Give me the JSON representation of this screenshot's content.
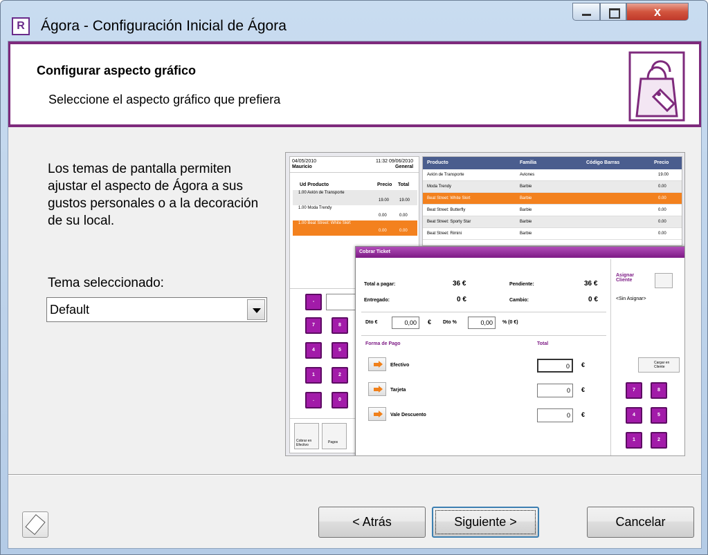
{
  "window": {
    "title": "Ágora - Configuración Inicial de Ágora",
    "app_icon_text": "R",
    "close_label": "x"
  },
  "header": {
    "title": "Configurar aspecto gráfico",
    "subtitle": "Seleccione el aspecto gráfico que prefiera"
  },
  "content": {
    "description": "Los temas de pantalla permiten ajustar el aspecto de Ágora a sus gustos personales o a la decoración de su local.",
    "theme_label": "Tema seleccionado:",
    "theme_value": "Default"
  },
  "preview": {
    "left_date": "04/05/2010",
    "left_user": "Mauricio",
    "left_time": "11:32 09/06/2010",
    "left_mode": "General",
    "col_ud_producto": "Ud Producto",
    "col_precio": "Precio",
    "col_total": "Total",
    "ticket_lines": [
      {
        "text": "1.00 Avión de Transporte",
        "price": "19.00",
        "total": "19.00"
      },
      {
        "text": "1.00 Moda Trendy",
        "price": "0.00",
        "total": "0.00"
      },
      {
        "text": "1.00 Beat Street: White Skirt",
        "price": "0.00",
        "total": "0.00"
      }
    ],
    "product_headers": [
      "Producto",
      "Familia",
      "Código Barras",
      "Precio"
    ],
    "products": [
      {
        "name": "Avión de Transporte",
        "family": "Aviones",
        "price": "19.00"
      },
      {
        "name": "Moda Trendy",
        "family": "Barbie",
        "price": "0.00"
      },
      {
        "name": "Beat Street: White Skirt",
        "family": "Barbie",
        "price": "0.00"
      },
      {
        "name": "Beat Street: Butterfly",
        "family": "Barbie",
        "price": "0.00"
      },
      {
        "name": "Beat Street: Sporty Star",
        "family": "Barbie",
        "price": "0.00"
      },
      {
        "name": "Beat Street: Rimini",
        "family": "Barbie",
        "price": "0.00"
      }
    ],
    "keypad": [
      "-",
      "7",
      "8",
      "4",
      "5",
      "1",
      "2",
      ".",
      "0"
    ],
    "bottom_buttons": [
      "Cobrar en Efectivo",
      "Pagos"
    ],
    "dialog": {
      "title": "Cobrar Ticket",
      "total_label": "Total a pagar:",
      "total_value": "36 €",
      "pending_label": "Pendiente:",
      "pending_value": "36 €",
      "delivered_label": "Entregado:",
      "delivered_value": "0 €",
      "change_label": "Cambio:",
      "change_value": "0 €",
      "dto_eur_label": "Dto €",
      "dto_eur_value": "0,00",
      "dto_pct_label": "Dto %",
      "dto_pct_value": "0,00",
      "pct_note": "% (0 €)",
      "currency": "€",
      "payment_header": "Forma de Pago",
      "payment_total_header": "Total",
      "payments": [
        {
          "name": "Efectivo",
          "value": "0"
        },
        {
          "name": "Tarjeta",
          "value": "0"
        },
        {
          "name": "Vale Descuento",
          "value": "0"
        }
      ],
      "assign_client_label": "Asignar Cliente",
      "no_client": "<Sin Asignar>",
      "load_client": "Cargar en Cliente",
      "dialog_keys": [
        "7",
        "8",
        "4",
        "5",
        "1",
        "2"
      ]
    }
  },
  "footer": {
    "back_label": "< Atrás",
    "next_label": "Siguiente >",
    "cancel_label": "Cancelar"
  },
  "colors": {
    "accent": "#7e2a7c",
    "keypad": "#a21ba9",
    "selected_row": "#f3811e",
    "table_header": "#4a5d8e"
  }
}
